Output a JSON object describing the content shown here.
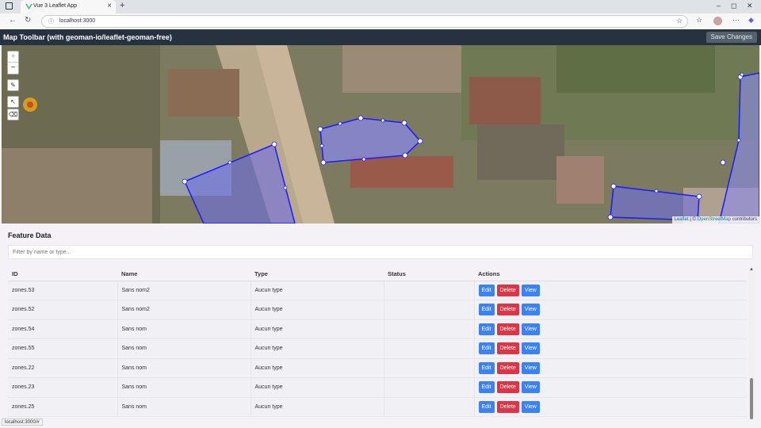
{
  "browser": {
    "tab_title": "Vue 3 Leaflet App",
    "url": "localhost:3000",
    "status_url": "localhost:3000/#"
  },
  "app": {
    "title": "Map Toolbar (with geoman-io/leaflet-geoman-free)",
    "save_label": "Save Changes"
  },
  "map": {
    "zoom_in": "+",
    "zoom_out": "−",
    "attribution_leaflet": "Leaflet",
    "attribution_sep": " | © ",
    "attribution_osm": "OpenStreetMap",
    "attribution_rest": " contributors"
  },
  "features": {
    "title": "Feature Data",
    "filter_placeholder": "Filter by name or type...",
    "columns": [
      "ID",
      "Name",
      "Type",
      "Status",
      "Actions"
    ],
    "actions": {
      "edit": "Edit",
      "delete": "Delete",
      "view": "View"
    },
    "rows": [
      {
        "id": "zones.53",
        "name": "Sans nom2",
        "type": "Aucun type",
        "status": ""
      },
      {
        "id": "zones.52",
        "name": "Sans nom2",
        "type": "Aucun type",
        "status": ""
      },
      {
        "id": "zones.54",
        "name": "Sans nom",
        "type": "Aucun type",
        "status": ""
      },
      {
        "id": "zones.55",
        "name": "Sans nom",
        "type": "Aucun type",
        "status": ""
      },
      {
        "id": "zones.22",
        "name": "Sans nom",
        "type": "Aucun type",
        "status": ""
      },
      {
        "id": "zones.23",
        "name": "Sans nom",
        "type": "Aucun type",
        "status": ""
      },
      {
        "id": "zones.25",
        "name": "Sans nom",
        "type": "Aucun type",
        "status": ""
      }
    ]
  },
  "colors": {
    "polygon_stroke": "#1a1aff",
    "polygon_fill": "#6e6ee6",
    "edit_button": "#3b82f6",
    "delete_button": "#dc3545"
  }
}
